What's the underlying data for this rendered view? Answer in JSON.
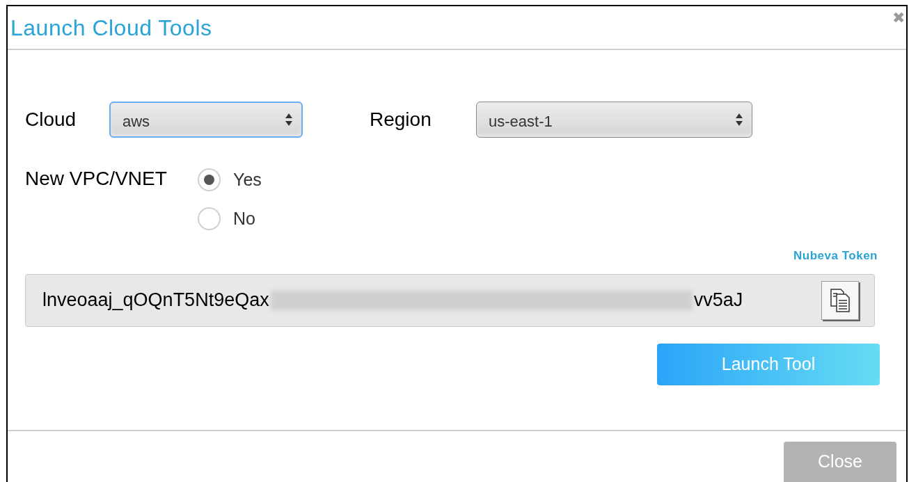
{
  "dialog": {
    "title": "Launch Cloud Tools",
    "close_icon": "✖"
  },
  "fields": [
    {
      "label": "Cloud",
      "value": "aws",
      "focused": true
    },
    {
      "label": "Region",
      "value": "us-east-1",
      "focused": false
    }
  ],
  "new_vpc": {
    "label": "New VPC/VNET",
    "options": [
      {
        "label": "Yes",
        "selected": true
      },
      {
        "label": "No",
        "selected": false
      }
    ]
  },
  "token": {
    "label": "Nubeva Token",
    "value_start": "lnveoaaj_qOQnT5Nt9eQax",
    "value_end": "vv5aJ"
  },
  "buttons": [
    {
      "label": "Launch Tool",
      "kind": "primary"
    },
    {
      "label": "Close",
      "kind": "disabled"
    }
  ]
}
